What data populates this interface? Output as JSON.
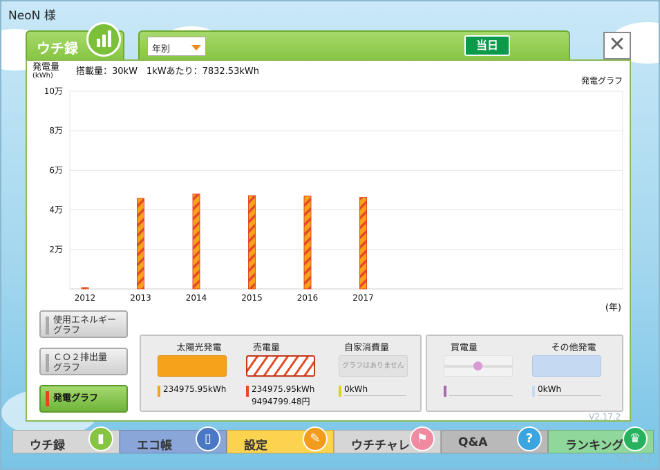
{
  "user": {
    "name": "NeoN 様"
  },
  "tab": {
    "label": "ウチ録"
  },
  "period_select": {
    "value": "年別"
  },
  "today_button": {
    "label": "当日"
  },
  "close_button": {
    "label": "✕"
  },
  "chart_header": {
    "ylabel": "発電量",
    "yunit": "(kWh)",
    "info": "搭載量：30kW　1kWあたり：7832.53kWh",
    "title": "発電グラフ",
    "xunit": "(年)"
  },
  "chart_data": {
    "type": "bar",
    "title": "発電グラフ",
    "ylabel": "発電量 (kWh)",
    "xlabel": "(年)",
    "categories": [
      "2012",
      "2013",
      "2014",
      "2015",
      "2016",
      "2017"
    ],
    "series": [
      {
        "name": "売電量",
        "values": [
          700,
          45800,
          48000,
          47200,
          47000,
          46300
        ]
      }
    ],
    "ylim": [
      0,
      100000
    ],
    "yticks": [
      20000,
      40000,
      60000,
      80000,
      100000
    ],
    "ytick_labels": [
      "2万",
      "4万",
      "6万",
      "8万",
      "10万"
    ],
    "grid": true,
    "colors": {
      "fill": "#f7a21b",
      "stripe": "#e54a24"
    }
  },
  "side_buttons": [
    {
      "label": "使用エネルギー\nグラフ"
    },
    {
      "label": "ＣＯ２排出量\nグラフ"
    },
    {
      "label": "発電グラフ"
    }
  ],
  "legend": {
    "solar": {
      "name": "太陽光発電",
      "value": "234975.95kWh",
      "color": "#f7a21b"
    },
    "sell": {
      "name": "売電量",
      "value": "234975.95kWh",
      "value2": "9494799.48円",
      "color": "#e54a24"
    },
    "self": {
      "name": "自家消費量",
      "value": "0kWh",
      "empty_text": "グラフはありません",
      "color": "#dcd41f"
    },
    "buy": {
      "name": "買電量",
      "color": "#a66ba6"
    },
    "other": {
      "name": "その他発電",
      "value": "0kWh",
      "color": "#c5daf2"
    }
  },
  "bottom_nav": [
    {
      "label": "ウチ録",
      "color": "#d6d6d6",
      "icon_color": "#86c442",
      "icon": "chart-icon"
    },
    {
      "label": "エコ帳",
      "color": "#8aa6d8",
      "icon_color": "#4a78c4",
      "icon": "notebook-icon"
    },
    {
      "label": "設定",
      "color": "#fbd34f",
      "icon_color": "#f29c1f",
      "icon": "wrench-icon"
    },
    {
      "label": "ウチチャレ",
      "color": "#d6d6d6",
      "icon_color": "#ef8aa1",
      "icon": "flag-icon"
    },
    {
      "label": "Q&A",
      "color": "#b9b9b9",
      "icon_color": "#3aa5de",
      "icon": "question-icon"
    },
    {
      "label": "ランキング",
      "color": "#8fd79a",
      "icon_color": "#27b35e",
      "icon": "crown-icon"
    }
  ],
  "watermark": "V2.17.2",
  "version": "V2.19.1"
}
